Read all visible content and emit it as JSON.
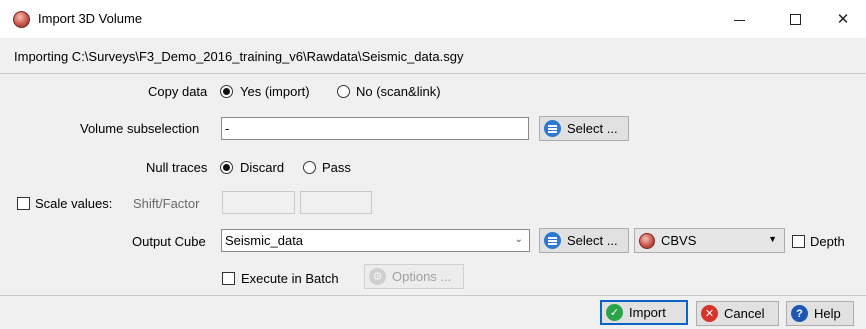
{
  "window": {
    "title": "Import 3D Volume",
    "controls": {
      "minimize": "—",
      "maximize": "☐",
      "close": "✕"
    }
  },
  "importing_path": "Importing C:\\Surveys\\F3_Demo_2016_training_v6\\Rawdata\\Seismic_data.sgy",
  "copy_data": {
    "label": "Copy data",
    "options": [
      "Yes (import)",
      "No (scan&link)"
    ],
    "selected": "Yes (import)"
  },
  "volume_subselection": {
    "label": "Volume subselection",
    "value": "-",
    "select_label": "Select ..."
  },
  "null_traces": {
    "label": "Null traces",
    "options": [
      "Discard",
      "Pass"
    ],
    "selected": "Discard"
  },
  "scale_values": {
    "label": "Scale values:",
    "checked": false,
    "sublabel": "Shift/Factor",
    "shift": "",
    "factor": ""
  },
  "output_cube": {
    "label": "Output Cube",
    "value": "Seismic_data",
    "select_label": "Select ...",
    "format": "CBVS",
    "depth_label": "Depth",
    "depth_checked": false
  },
  "batch": {
    "label": "Execute in Batch",
    "checked": false,
    "options_label": "Options ..."
  },
  "footer": {
    "import_label": "Import",
    "cancel_label": "Cancel",
    "help_label": "Help"
  },
  "colors": {
    "accent": "#0a64c8",
    "import_icon": "#2aa54a",
    "cancel_icon": "#d8342c",
    "help_icon": "#1d56b3",
    "select_icon": "#2b79d3"
  }
}
